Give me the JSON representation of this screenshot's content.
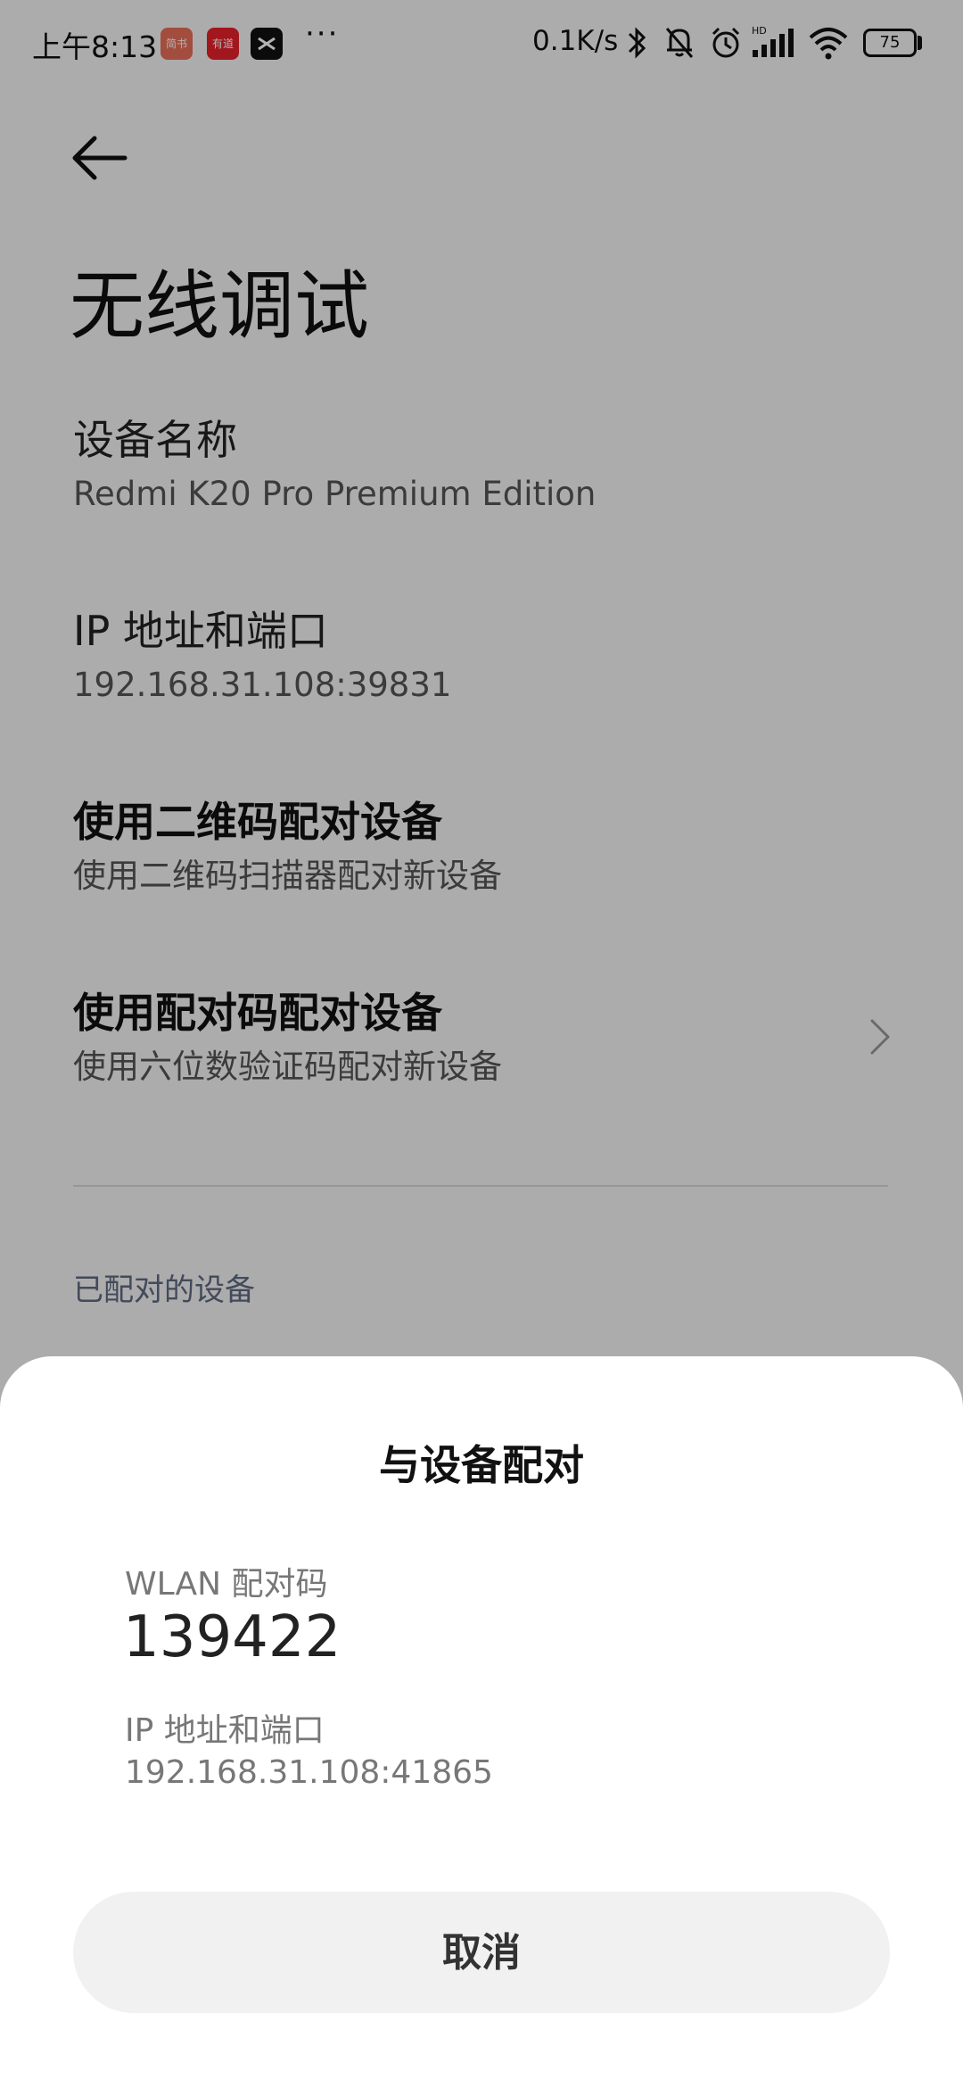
{
  "status_bar": {
    "time": "上午8:13",
    "apps": [
      {
        "icon": "jianshu-app-icon",
        "label": "简书",
        "color": "#ea6f5a"
      },
      {
        "icon": "youdao-app-icon",
        "label": "有道",
        "color": "#e8212a"
      },
      {
        "icon": "capcut-app-icon",
        "label": "",
        "color": "#111111"
      }
    ],
    "more": "···",
    "net_speed": "0.1K/s",
    "icons": [
      "bluetooth-icon",
      "mute-bell-icon",
      "alarm-icon",
      "hd-signal-icon",
      "wifi-icon"
    ],
    "battery": "75"
  },
  "header": {
    "back_icon": "back-arrow-icon",
    "title": "无线调试"
  },
  "settings": [
    {
      "title": "设备名称",
      "subtitle": "Redmi K20 Pro Premium Edition"
    },
    {
      "title": "IP 地址和端口",
      "subtitle": "192.168.31.108:39831"
    },
    {
      "title": "使用二维码配对设备",
      "subtitle": "使用二维码扫描器配对新设备"
    },
    {
      "title": "使用配对码配对设备",
      "subtitle": "使用六位数验证码配对新设备"
    }
  ],
  "paired_section_label": "已配对的设备",
  "dialog": {
    "title": "与设备配对",
    "code_label": "WLAN 配对码",
    "code_value": "139422",
    "ip_label": "IP 地址和端口",
    "ip_value": "192.168.31.108:41865",
    "cancel_label": "取消"
  },
  "colors": {
    "background": "#f7f7f7",
    "overlay": "rgba(0,0,0,0.30)",
    "sheet": "#ffffff",
    "button": "#f1f1f1",
    "section_label": "#5f6a83"
  }
}
